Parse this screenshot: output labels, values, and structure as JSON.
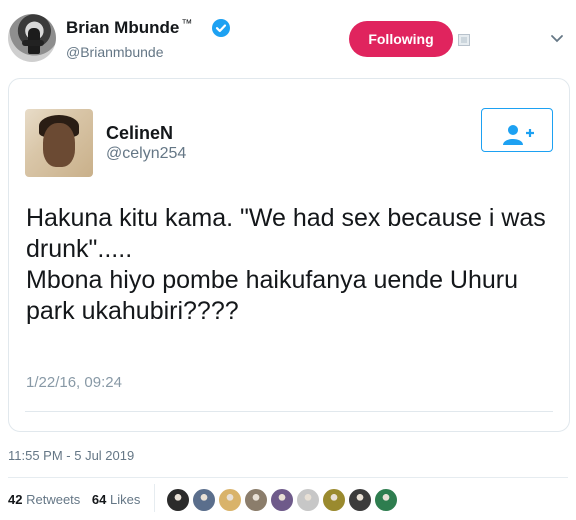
{
  "tweet": {
    "author_name": "Brian Mbunde",
    "author_tm": "™",
    "author_handle": "@Brianmbunde",
    "follow_button_label": "Following",
    "timestamp": "11:55 PM - 5 Jul 2019",
    "retweets_count": "42",
    "retweets_label": "Retweets",
    "likes_count": "64",
    "likes_label": "Likes"
  },
  "quoted_tweet": {
    "author_name": "CelineN",
    "author_handle": "@celyn254",
    "text": "Hakuna kitu kama. \"We had sex because i was drunk\".....\nMbona hiyo pombe haikufanya uende Uhuru park ukahubiri????",
    "date": "1/22/16, 09:24"
  },
  "colors": {
    "following_button": "#e0245e",
    "verified_badge": "#1da1f2",
    "follow_outline": "#1da1f2"
  },
  "icons": [
    "verified-badge-icon",
    "external-tweet-icon",
    "chevron-down-icon",
    "follow-user-icon"
  ],
  "likers": [
    {
      "color": "#2b2b2b"
    },
    {
      "color": "#5a6e8c"
    },
    {
      "color": "#d9b36a"
    },
    {
      "color": "#8b7d6b"
    },
    {
      "color": "#6e5a8a"
    },
    {
      "color": "#c7c7c7"
    },
    {
      "color": "#9a8a2e"
    },
    {
      "color": "#3b3b3b"
    },
    {
      "color": "#2e7d4f"
    }
  ]
}
